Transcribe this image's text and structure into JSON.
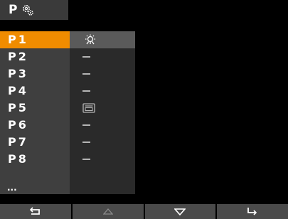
{
  "header": {
    "title": "P",
    "icon": "gear-icon"
  },
  "list": {
    "items": [
      {
        "label": "P1",
        "icon": "light-bulb-icon",
        "selected": true
      },
      {
        "label": "P2",
        "icon": "dash-icon"
      },
      {
        "label": "P3",
        "icon": "dash-icon"
      },
      {
        "label": "P4",
        "icon": "dash-icon"
      },
      {
        "label": "P5",
        "icon": "device-icon"
      },
      {
        "label": "P6",
        "icon": "dash-icon"
      },
      {
        "label": "P7",
        "icon": "dash-icon"
      },
      {
        "label": "P8",
        "icon": "dash-icon"
      }
    ],
    "more": "..."
  },
  "footer": {
    "buttons": [
      {
        "icon": "back-icon",
        "enabled": true
      },
      {
        "icon": "up-arrow-icon",
        "enabled": false
      },
      {
        "icon": "down-arrow-icon",
        "enabled": true
      },
      {
        "icon": "enter-icon",
        "enabled": true
      }
    ]
  },
  "colors": {
    "selected": "#f08c00",
    "names_bg": "#3f3f3f",
    "icons_bg": "#2a2a2a",
    "footer_bg": "#4a4a4a"
  }
}
